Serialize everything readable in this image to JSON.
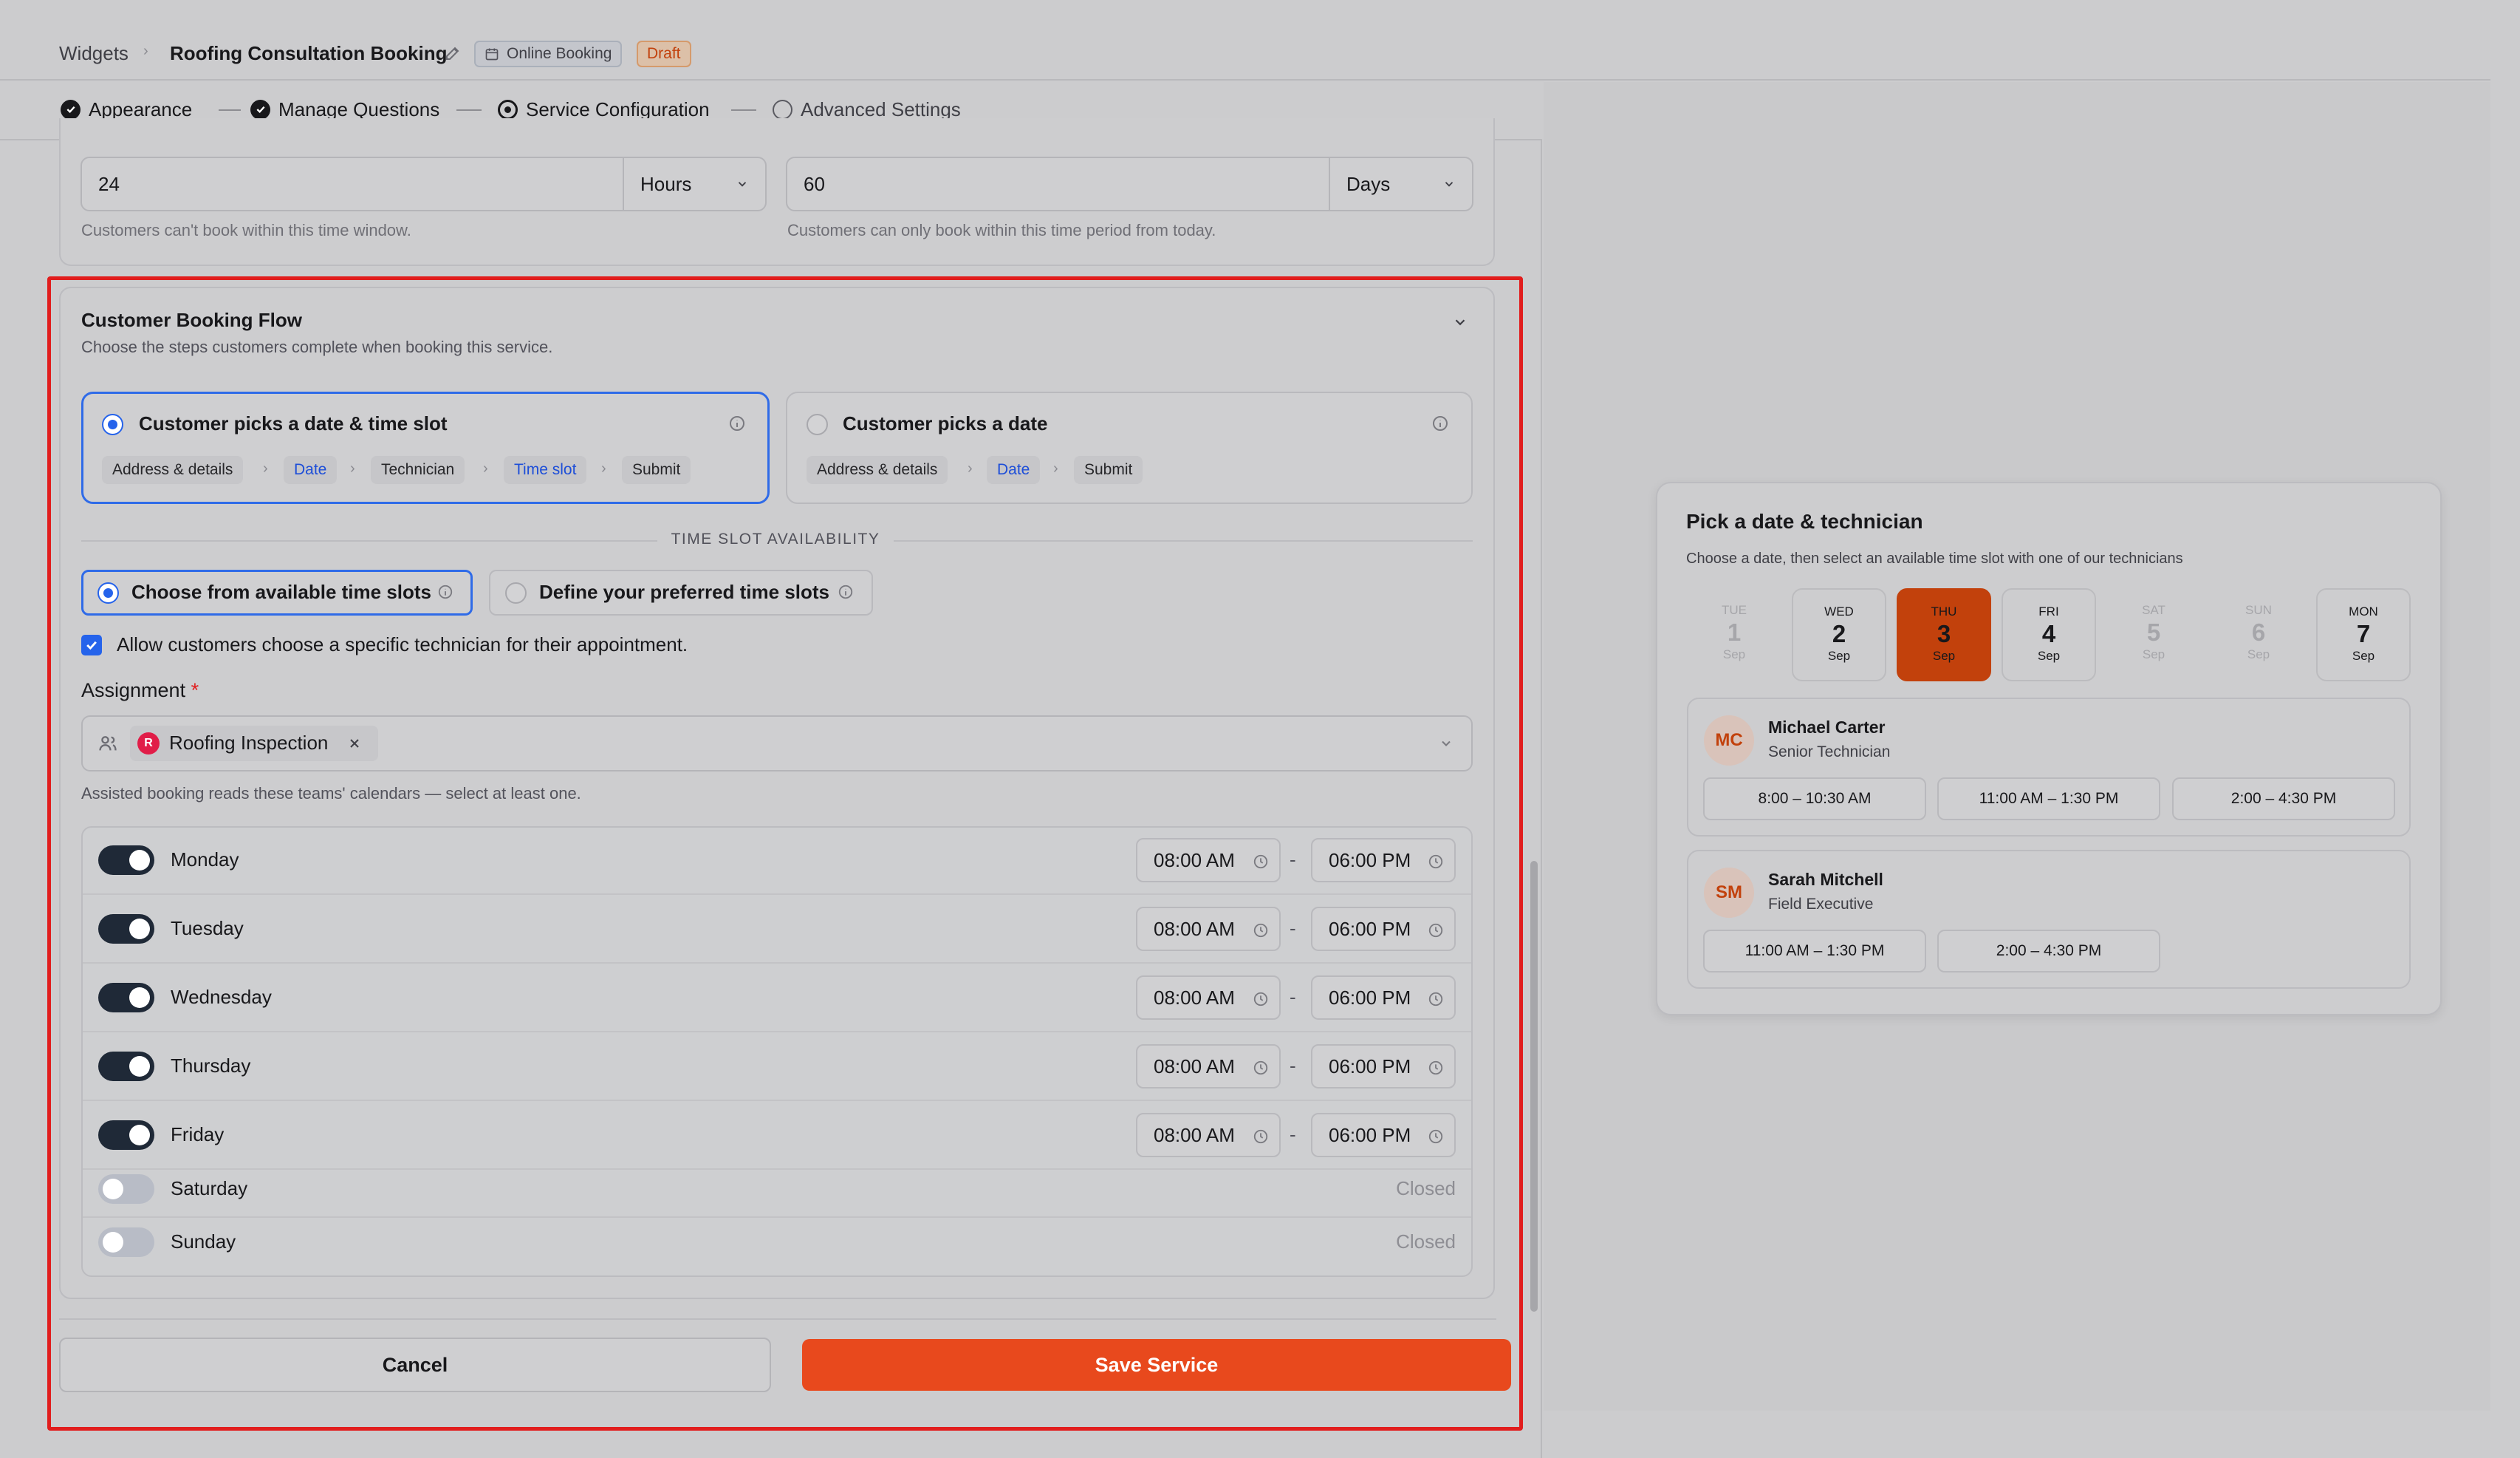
{
  "breadcrumb": {
    "root": "Widgets",
    "current": "Roofing Consultation Booking",
    "type_badge": "Online Booking",
    "status_badge": "Draft"
  },
  "steps": [
    {
      "label": "Appearance",
      "state": "done"
    },
    {
      "label": "Manage Questions",
      "state": "done"
    },
    {
      "label": "Service Configuration",
      "state": "current"
    },
    {
      "label": "Advanced Settings",
      "state": "todo"
    }
  ],
  "booking_window": {
    "min_notice": {
      "value": "24",
      "unit": "Hours",
      "help": "Customers can't book within this time window."
    },
    "max_advance": {
      "value": "60",
      "unit": "Days",
      "help": "Customers can only book within this time period from today."
    }
  },
  "booking_flow": {
    "title": "Customer Booking Flow",
    "subtitle": "Choose the steps customers complete when booking this service.",
    "options": [
      {
        "title": "Customer picks a date & time slot",
        "selected": true,
        "steps": [
          "Address & details",
          "Date",
          "Technician",
          "Time slot",
          "Submit"
        ]
      },
      {
        "title": "Customer picks a date",
        "selected": false,
        "steps": [
          "Address & details",
          "Date",
          "Submit"
        ]
      }
    ],
    "availability_heading": "TIME SLOT AVAILABILITY",
    "availability_options": [
      {
        "label": "Choose from available time slots",
        "selected": true
      },
      {
        "label": "Define your preferred time slots",
        "selected": false
      }
    ],
    "technician_checkbox": {
      "label": "Allow customers choose a specific technician for their appointment.",
      "checked": true
    },
    "assignment": {
      "label": "Assignment",
      "required_mark": "*",
      "tag_initial": "R",
      "tag": "Roofing Inspection",
      "help": "Assisted booking reads these teams' calendars — select at least one."
    },
    "hours": [
      {
        "day": "Monday",
        "enabled": true,
        "start": "08:00 AM",
        "end": "06:00 PM"
      },
      {
        "day": "Tuesday",
        "enabled": true,
        "start": "08:00 AM",
        "end": "06:00 PM"
      },
      {
        "day": "Wednesday",
        "enabled": true,
        "start": "08:00 AM",
        "end": "06:00 PM"
      },
      {
        "day": "Thursday",
        "enabled": true,
        "start": "08:00 AM",
        "end": "06:00 PM"
      },
      {
        "day": "Friday",
        "enabled": true,
        "start": "08:00 AM",
        "end": "06:00 PM"
      },
      {
        "day": "Saturday",
        "enabled": false,
        "closed_label": "Closed"
      },
      {
        "day": "Sunday",
        "enabled": false,
        "closed_label": "Closed"
      }
    ],
    "range_dash": "-"
  },
  "actions": {
    "cancel": "Cancel",
    "save": "Save Service"
  },
  "preview": {
    "title": "Pick a date & technician",
    "subtitle": "Choose a date, then select an available time slot with one of our technicians",
    "dates": [
      {
        "dow": "TUE",
        "day": "1",
        "month": "Sep",
        "state": "disabled"
      },
      {
        "dow": "WED",
        "day": "2",
        "month": "Sep",
        "state": "available"
      },
      {
        "dow": "THU",
        "day": "3",
        "month": "Sep",
        "state": "selected"
      },
      {
        "dow": "FRI",
        "day": "4",
        "month": "Sep",
        "state": "available"
      },
      {
        "dow": "SAT",
        "day": "5",
        "month": "Sep",
        "state": "disabled"
      },
      {
        "dow": "SUN",
        "day": "6",
        "month": "Sep",
        "state": "disabled"
      },
      {
        "dow": "MON",
        "day": "7",
        "month": "Sep",
        "state": "available"
      }
    ],
    "technicians": [
      {
        "initials": "MC",
        "name": "Michael Carter",
        "role": "Senior Technician",
        "slots": [
          "8:00 – 10:30 AM",
          "11:00 AM – 1:30 PM",
          "2:00 – 4:30 PM"
        ]
      },
      {
        "initials": "SM",
        "name": "Sarah Mitchell",
        "role": "Field Executive",
        "slots": [
          "11:00 AM – 1:30 PM",
          "2:00 – 4:30 PM"
        ]
      }
    ]
  },
  "colors": {
    "accent": "#2563eb",
    "primary": "#e8491d",
    "highlight": "#e11d1d",
    "selected_date": "#c2410c"
  }
}
